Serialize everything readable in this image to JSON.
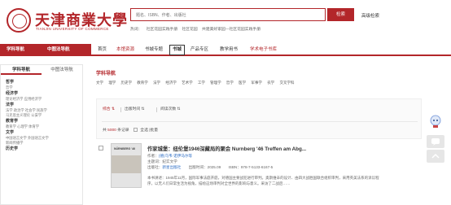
{
  "brand": {
    "name_cn": "天津商業大學",
    "name_en": "TIANJIN UNIVERSITY OF COMMERCE"
  },
  "search": {
    "placeholder": "题名、ISBN、作者、出版社",
    "button_label": "检索",
    "advanced_label": "高级检索"
  },
  "hotwords": [
    "热词：",
    "社区花园实践手册",
    "社区花园",
    "共建美好家园—社区花园实践手册"
  ],
  "nav": {
    "left": [
      "学科导航",
      "中图法导航"
    ],
    "items": [
      "首页",
      "本馆资源",
      "书城专题",
      "书城",
      "产品专区",
      "教学用书",
      "学术电子书库"
    ]
  },
  "sidebar": {
    "tabs": [
      "学科导航",
      "中图法导航"
    ],
    "groups": [
      {
        "title": "哲学",
        "subs": "哲学"
      },
      {
        "title": "经济学",
        "subs": "理论经济学  应用经济学"
      },
      {
        "title": "法学",
        "subs": "法学  政治学  社会学  民族学"
      },
      {
        "title": "",
        "subs": "马克思主义理论  公安学"
      },
      {
        "title": "教育学",
        "subs": "教育学  心理学  体育学"
      },
      {
        "title": "文学",
        "subs": "中国语言文学  外国语言文学"
      },
      {
        "title": "",
        "subs": "新闻传播学"
      },
      {
        "title": "历史学",
        "subs": ""
      }
    ]
  },
  "main": {
    "section_title": "学科导航",
    "subjects": [
      "文学",
      "理学",
      "历史学",
      "教育学",
      "法学",
      "经济学",
      "艺术学",
      "工学",
      "管理学",
      "哲学",
      "医学",
      "军事学",
      "农学",
      "交叉学科"
    ],
    "sort_chips": [
      "综合",
      "出版时间",
      "阅读次数"
    ],
    "result_prefix": "共",
    "result_count": "5000",
    "result_suffix": "条记录",
    "select_all": "全选",
    "batch": "|批量"
  },
  "book": {
    "title": "作家城堡：纽伦堡1946深藏局的聚会 Nurnberg '46 Treffen am Abg...",
    "author_label": "作者：",
    "author_value": "(德)乌韦·诺伊马尔等",
    "editor_label": "主题词：",
    "editor_value": "纪实文学",
    "publisher_label": "出版社：",
    "publisher_value": "新星出版社",
    "pubdate_label": "出版时间：",
    "pubdate_value": "2025.09",
    "isbn_label": "ISBN：",
    "isbn_value": "978-7-5133-6167-5",
    "cover_text": "NÜRNBERG '46",
    "description": "本书讲述：1945年11月，国际军事法庭开庭，对德国主要战犯进行审判。奥斯维辛的设计、由四大战胜国联合组织审判，采用英美法系的诉讼程序，以无人们日常生活为视角，描绘这场审判对全世界的影响与意义。采访了二战后……"
  }
}
